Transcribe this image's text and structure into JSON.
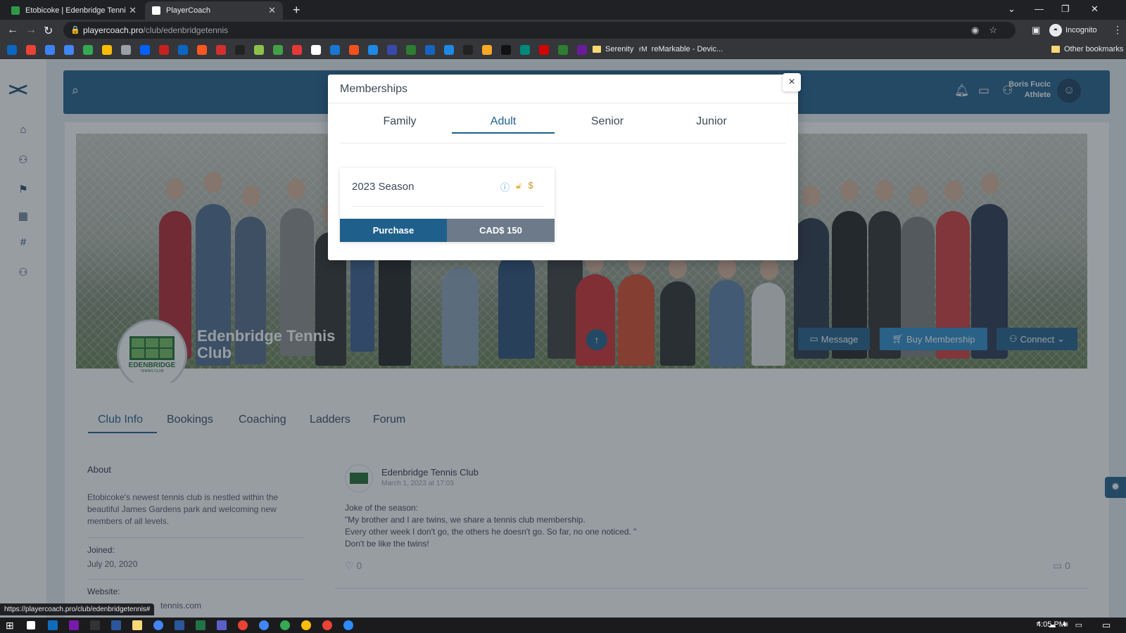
{
  "browser": {
    "tabs": [
      {
        "title": "Etobicoke | Edenbridge Tennis Cl",
        "favicon_color": "#2e9a47"
      },
      {
        "title": "PlayerCoach",
        "favicon_color": "#ffffff"
      }
    ],
    "url_host": "playercoach.pro",
    "url_path": "/club/edenbridgetennis",
    "profile_label": "Incognito",
    "bookmarks": [
      {
        "label": "Serenity"
      },
      {
        "label": "reMarkable - Devic..."
      },
      {
        "label": "Other bookmarks"
      }
    ],
    "status_url": "https://playercoach.pro/club/edenbridgetennis#"
  },
  "header": {
    "user_name": "Boris Fucic",
    "user_role": "Athlete"
  },
  "club": {
    "name": "Edenbridge Tennis Club",
    "type": "Club",
    "logo_word": "EDENBRIDGE",
    "logo_sub": "TENNIS CLUB",
    "actions": {
      "message": "Message",
      "buy_membership": "Buy Membership",
      "connect": "Connect"
    }
  },
  "page_tabs": [
    "Club Info",
    "Bookings",
    "Coaching",
    "Ladders",
    "Forum"
  ],
  "about": {
    "heading": "About",
    "text": "Etobicoke's newest tennis club is nestled within the beautiful James Gardens park and welcoming new members of all levels.",
    "joined_label": "Joined:",
    "joined_value": "July 20, 2020",
    "website_label": "Website:",
    "website_value": "tennis.com"
  },
  "post": {
    "author": "Edenbridge Tennis Club",
    "date": "March 1, 2023 at 17:03",
    "lines": [
      "Joke of the season:",
      "\"My brother and I are twins, we share a tennis club membership.",
      "Every other week I don't go, the others he doesn't go. So far, no one noticed. \"",
      "Don't be like the twins!"
    ],
    "likes": "0",
    "comments": "0"
  },
  "modal": {
    "title": "Memberships",
    "close": "×",
    "tabs": [
      "Family",
      "Adult",
      "Senior",
      "Junior"
    ],
    "active_tab": "Adult",
    "card": {
      "title": "2023 Season",
      "purchase_label": "Purchase",
      "price_label": "CAD$ 150"
    }
  },
  "taskbar": {
    "time": "4:05 PM"
  },
  "colors": {
    "primary": "#1f5f8b",
    "accent": "#2d8cc9",
    "price_bg": "#6c7a89"
  }
}
